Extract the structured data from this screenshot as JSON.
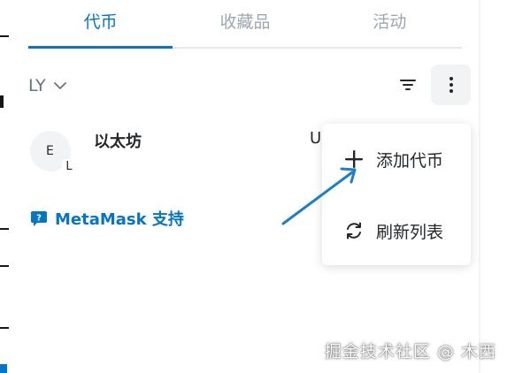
{
  "tabs": [
    {
      "label": "代币",
      "active": true
    },
    {
      "label": "收藏品",
      "active": false
    },
    {
      "label": "活动",
      "active": false
    }
  ],
  "account": {
    "name": "LY"
  },
  "token": {
    "avatar_letter": "E",
    "badge_letter": "L",
    "name": "以太坊",
    "fiat_partial": "U"
  },
  "support": {
    "label": "MetaMask 支持"
  },
  "menu": {
    "items": [
      {
        "label": "添加代币",
        "icon": "plus-icon"
      },
      {
        "label": "刷新列表",
        "icon": "refresh-icon"
      }
    ]
  },
  "watermark": "掘金技术社区 @ 木西",
  "colors": {
    "accent": "#0376c9",
    "text": "#24272a",
    "muted": "#9fa6ae",
    "surface": "#f2f3f4"
  }
}
